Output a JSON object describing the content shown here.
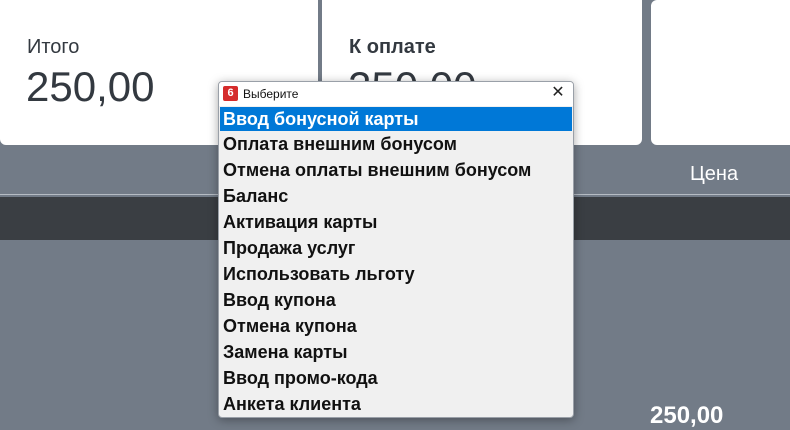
{
  "cards": {
    "total": {
      "label": "Итого",
      "value": "250,00"
    },
    "to_pay": {
      "label": "К оплате",
      "value": "250,00"
    }
  },
  "table": {
    "price_header": "Цена",
    "row_price": "250,00"
  },
  "dialog": {
    "app_icon": "6",
    "title": "Выберите",
    "close_glyph": "✕",
    "selected_index": 0,
    "items": [
      "Ввод бонусной карты",
      "Оплата внешним бонусом",
      "Отмена оплаты внешним бонусом",
      "Баланс",
      "Активация карты",
      "Продажа услуг",
      "Использовать льготу",
      "Ввод купона",
      "Отмена купона",
      "Замена карты",
      "Ввод промо-кода",
      "Анкета клиента"
    ]
  },
  "colors": {
    "background": "#727b87",
    "selection": "#0078d7",
    "app_icon": "#d52b2b"
  }
}
